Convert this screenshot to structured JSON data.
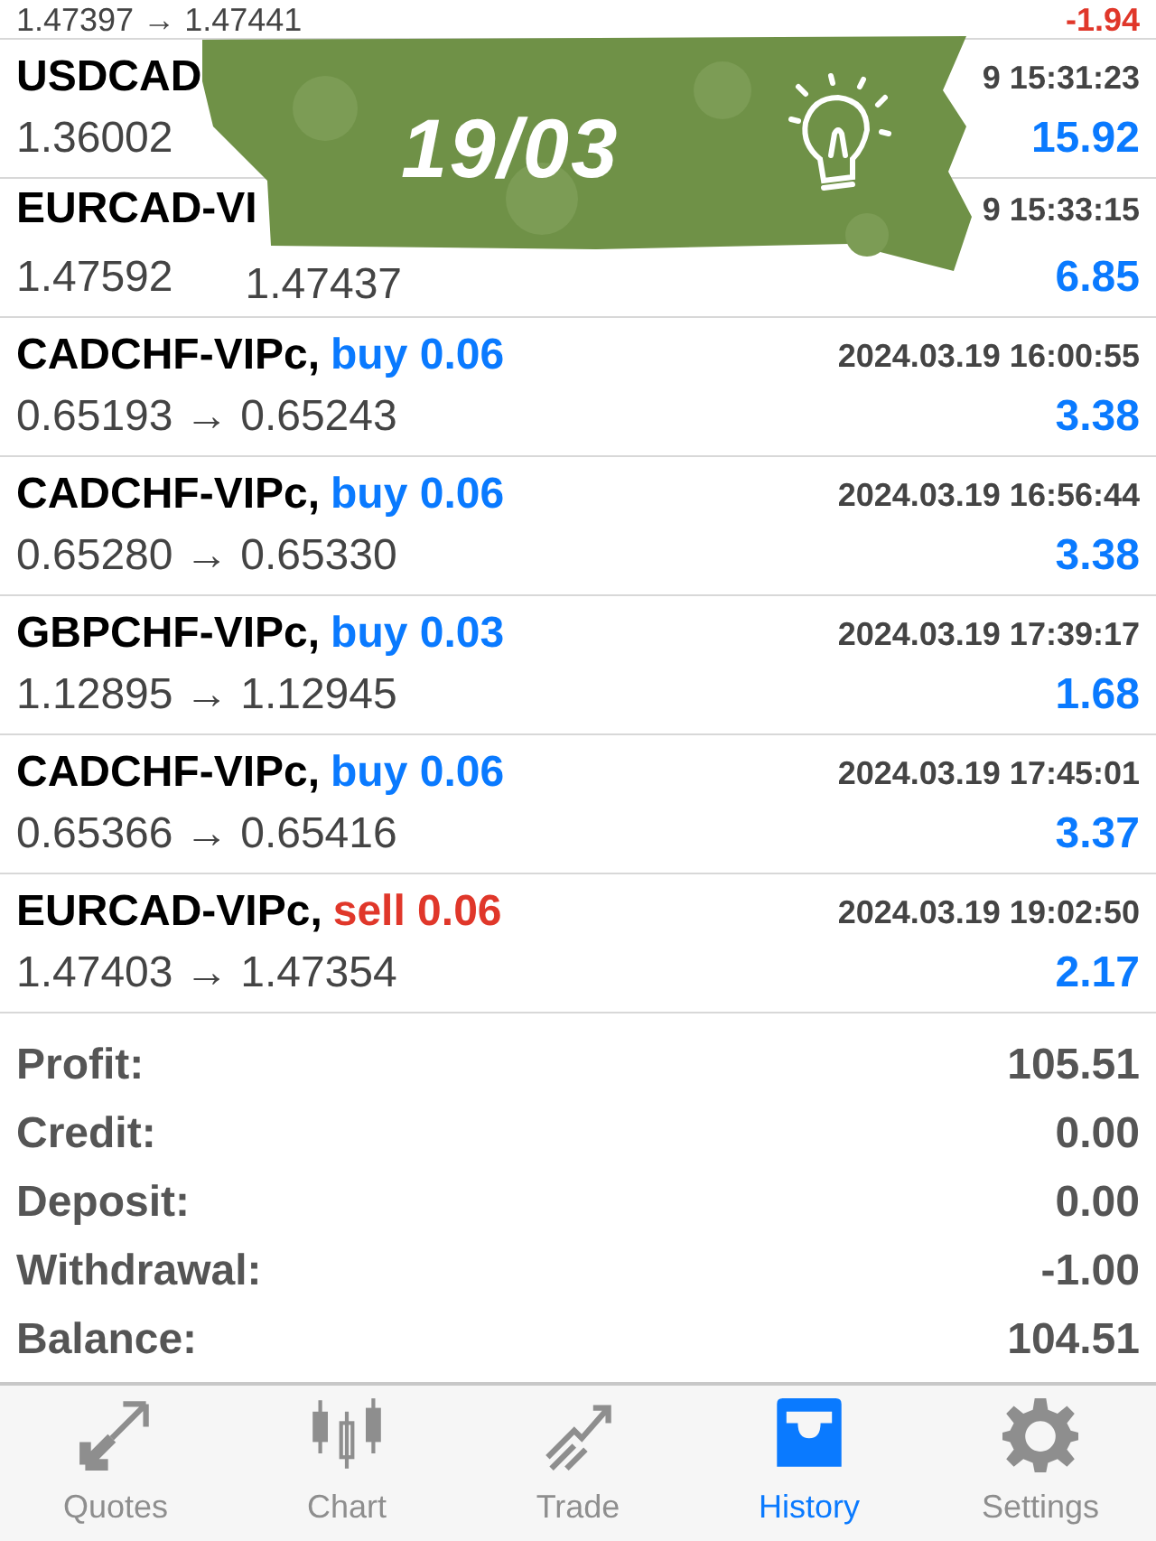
{
  "sticker": {
    "text": "19/03"
  },
  "trades": [
    {
      "price": "1.47397 → 1.47441",
      "profit": "-1.94",
      "loss": true
    },
    {
      "symbol": "USDCAD",
      "time": "9 15:31:23",
      "price": "1.36002",
      "profit": "15.92",
      "loss": false
    },
    {
      "symbol": "EURCAD-VI",
      "time": "9 15:33:15",
      "price": "1.47592",
      "price_end": "1.47437",
      "profit": "6.85",
      "loss": false
    },
    {
      "symbol": "CADCHF-VIPc,",
      "kind": "buy",
      "order": "buy 0.06",
      "time": "2024.03.19 16:00:55",
      "price": "0.65193 → 0.65243",
      "profit": "3.38",
      "loss": false
    },
    {
      "symbol": "CADCHF-VIPc,",
      "kind": "buy",
      "order": "buy 0.06",
      "time": "2024.03.19 16:56:44",
      "price": "0.65280 → 0.65330",
      "profit": "3.38",
      "loss": false
    },
    {
      "symbol": "GBPCHF-VIPc,",
      "kind": "buy",
      "order": "buy 0.03",
      "time": "2024.03.19 17:39:17",
      "price": "1.12895 → 1.12945",
      "profit": "1.68",
      "loss": false
    },
    {
      "symbol": "CADCHF-VIPc,",
      "kind": "buy",
      "order": "buy 0.06",
      "time": "2024.03.19 17:45:01",
      "price": "0.65366 → 0.65416",
      "profit": "3.37",
      "loss": false
    },
    {
      "symbol": "EURCAD-VIPc,",
      "kind": "sell",
      "order": "sell 0.06",
      "time": "2024.03.19 19:02:50",
      "price": "1.47403 → 1.47354",
      "profit": "2.17",
      "loss": false
    }
  ],
  "summary": [
    {
      "label": "Profit:",
      "value": "105.51"
    },
    {
      "label": "Credit:",
      "value": "0.00"
    },
    {
      "label": "Deposit:",
      "value": "0.00"
    },
    {
      "label": "Withdrawal:",
      "value": "-1.00"
    },
    {
      "label": "Balance:",
      "value": "104.51"
    }
  ],
  "tabs": [
    {
      "label": "Quotes",
      "selected": false
    },
    {
      "label": "Chart",
      "selected": false
    },
    {
      "label": "Trade",
      "selected": false
    },
    {
      "label": "History",
      "selected": true
    },
    {
      "label": "Settings",
      "selected": false
    }
  ]
}
